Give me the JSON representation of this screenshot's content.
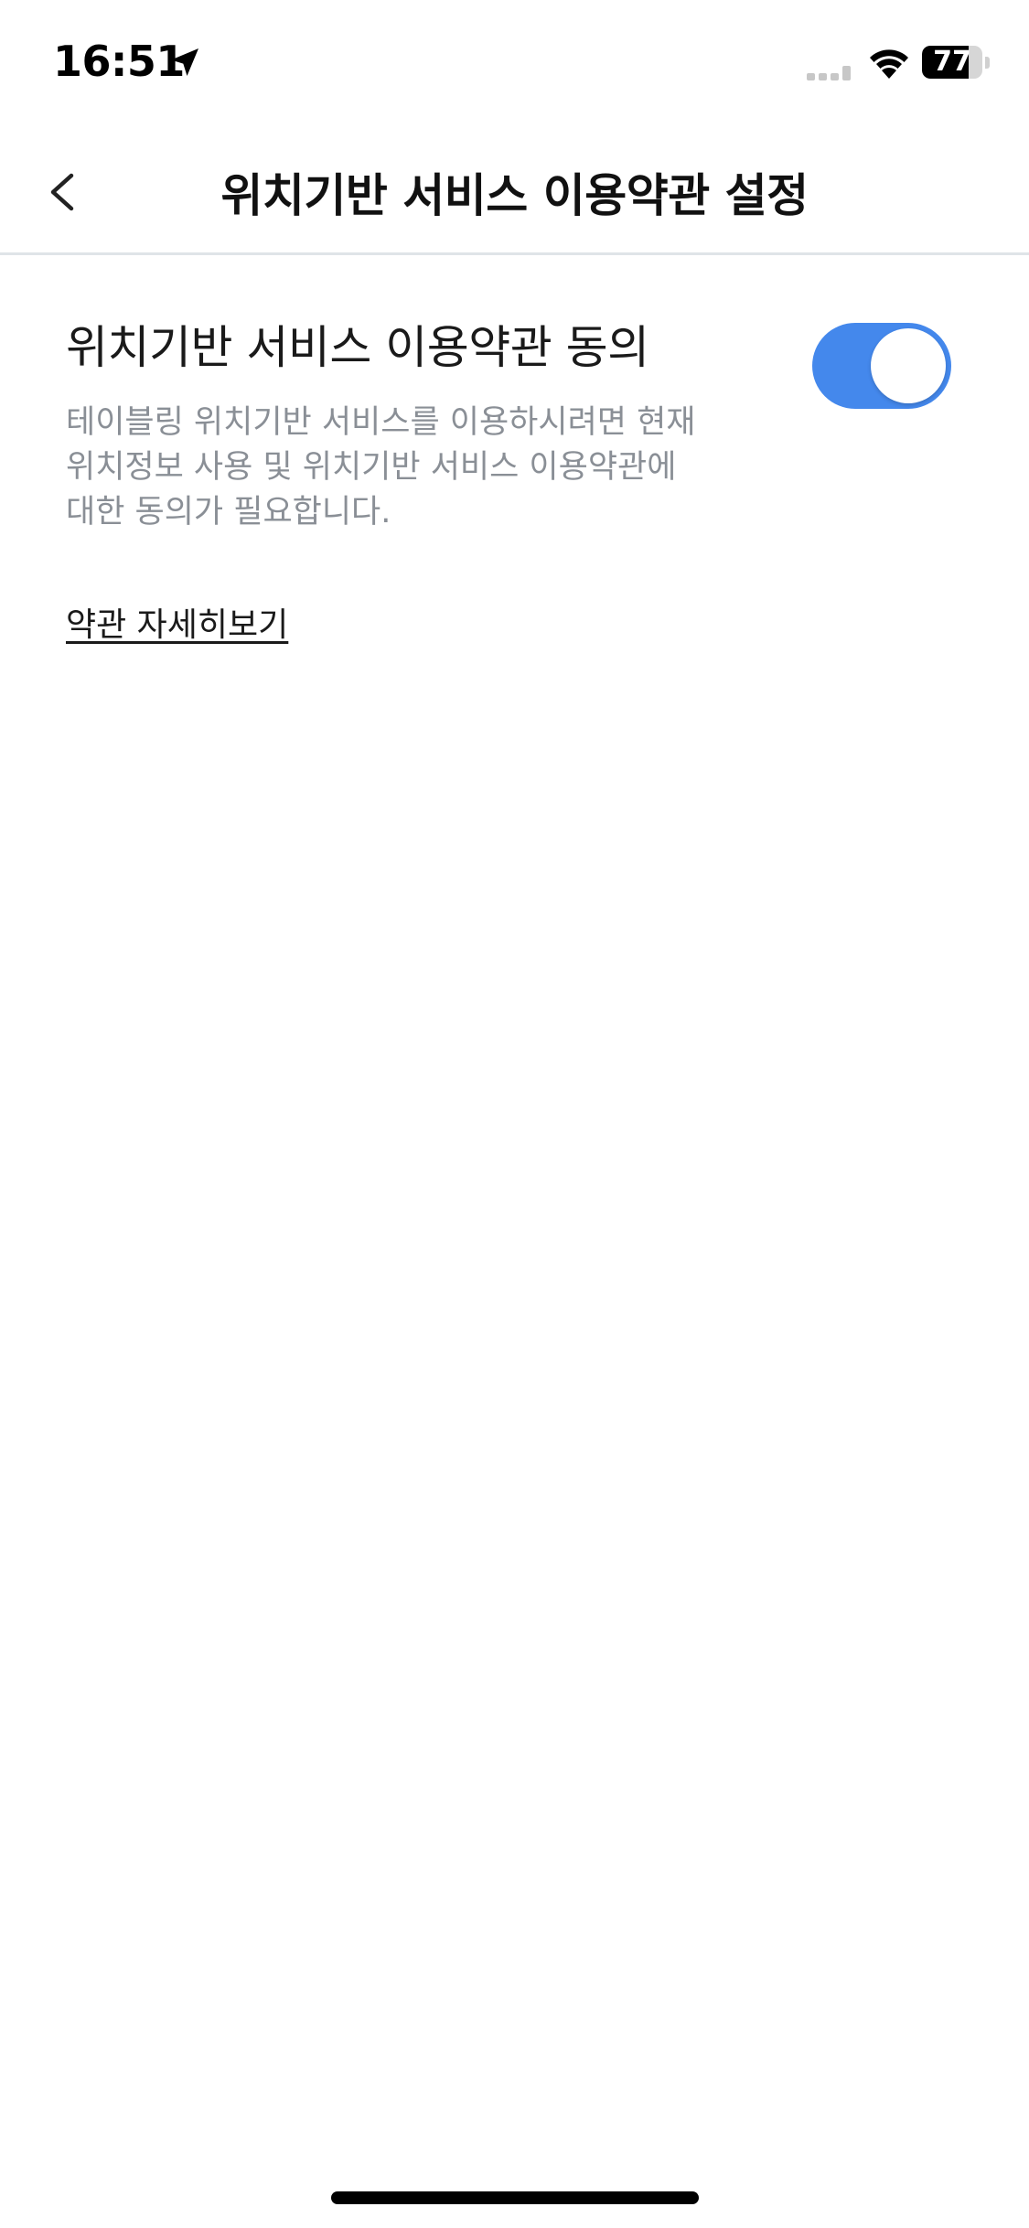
{
  "status_bar": {
    "time": "16:51",
    "battery_level": 77,
    "battery_text": "77",
    "location_icon": "location-arrow-icon",
    "signal_icon": "cellular-signal-icon",
    "wifi_icon": "wifi-icon"
  },
  "nav": {
    "back_icon": "chevron-left-icon",
    "title": "위치기반 서비스 이용약관 설정"
  },
  "setting": {
    "title": "위치기반 서비스 이용약관 동의",
    "description": "테이블링 위치기반 서비스를 이용하시려면 현재 위치정보 사용 및 위치기반 서비스 이용약관에 대한 동의가 필요합니다.",
    "toggle_on": true,
    "toggle_color": "#4488ec"
  },
  "links": {
    "terms_detail": "약관 자세히보기"
  },
  "colors": {
    "background": "#ffffff",
    "accent": "#4488ec",
    "description_text": "#8a8f96",
    "divider": "#dfe4e8"
  }
}
